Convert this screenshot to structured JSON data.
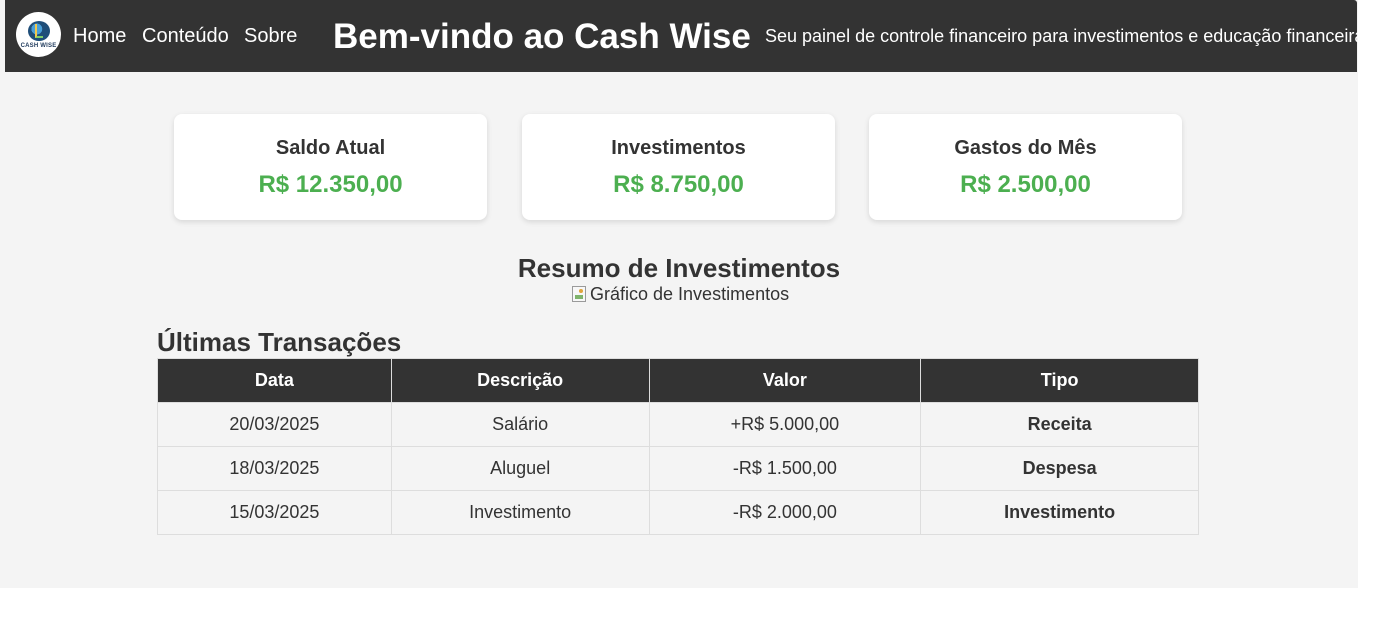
{
  "header": {
    "logo_text": "CASH WISE",
    "nav": [
      {
        "label": "Home"
      },
      {
        "label": "Conteúdo"
      },
      {
        "label": "Sobre"
      }
    ],
    "title": "Bem-vindo ao Cash Wise",
    "subtitle": "Seu painel de controle financeiro para investimentos e educação financeira"
  },
  "cards": [
    {
      "title": "Saldo Atual",
      "value": "R$ 12.350,00"
    },
    {
      "title": "Investimentos",
      "value": "R$ 8.750,00"
    },
    {
      "title": "Gastos do Mês",
      "value": "R$ 2.500,00"
    }
  ],
  "investments": {
    "title": "Resumo de Investimentos",
    "chart_alt": "Gráfico de Investimentos"
  },
  "transactions": {
    "title": "Últimas Transações",
    "columns": [
      "Data",
      "Descrição",
      "Valor",
      "Tipo"
    ],
    "rows": [
      {
        "date": "20/03/2025",
        "description": "Salário",
        "value": "+R$ 5.000,00",
        "type": "Receita"
      },
      {
        "date": "18/03/2025",
        "description": "Aluguel",
        "value": "-R$ 1.500,00",
        "type": "Despesa"
      },
      {
        "date": "15/03/2025",
        "description": "Investimento",
        "value": "-R$ 2.000,00",
        "type": "Investimento"
      }
    ]
  },
  "colors": {
    "header_bg": "#333333",
    "page_bg": "#f4f4f4",
    "value_green": "#4caf50",
    "type_income": "#008000",
    "type_expense": "#ff0000"
  }
}
